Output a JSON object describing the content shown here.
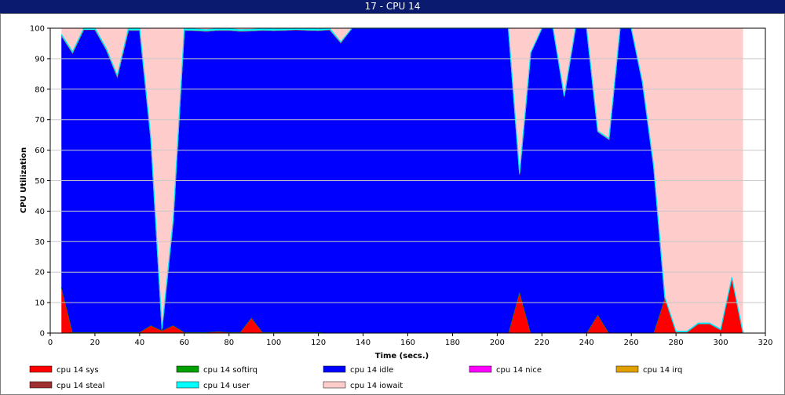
{
  "window": {
    "title": "17 - CPU 14"
  },
  "chart_data": {
    "type": "area",
    "stacked": true,
    "title": "17 - CPU 14",
    "xlabel": "Time (secs.)",
    "ylabel": "CPU Utilization",
    "xlim": [
      0,
      320
    ],
    "ylim": [
      0,
      100
    ],
    "xticks": [
      0,
      20,
      40,
      60,
      80,
      100,
      120,
      140,
      160,
      180,
      200,
      220,
      240,
      260,
      280,
      300,
      320
    ],
    "yticks": [
      0,
      10,
      20,
      30,
      40,
      50,
      60,
      70,
      80,
      90,
      100
    ],
    "grid": "horizontal",
    "legend_position": "bottom",
    "x": [
      5,
      10,
      15,
      20,
      25,
      30,
      35,
      40,
      45,
      50,
      55,
      60,
      65,
      70,
      75,
      80,
      85,
      90,
      95,
      100,
      105,
      110,
      115,
      120,
      125,
      130,
      135,
      140,
      145,
      150,
      155,
      160,
      165,
      170,
      175,
      180,
      185,
      190,
      195,
      200,
      205,
      210,
      215,
      220,
      225,
      230,
      235,
      240,
      245,
      250,
      255,
      260,
      265,
      270,
      275,
      280,
      285,
      290,
      295,
      300,
      305,
      310
    ],
    "series": [
      {
        "name": "cpu 14 sys",
        "color": "#ff0000",
        "values": [
          15,
          0.3,
          0.3,
          0.3,
          0.3,
          0.3,
          0.3,
          0.3,
          2.5,
          0.8,
          2.5,
          0.3,
          0.3,
          0.3,
          0.5,
          0.3,
          0.3,
          5,
          0.3,
          0.3,
          0.3,
          0.3,
          0.3,
          0.3,
          0,
          0,
          0,
          0,
          0,
          0,
          0,
          0,
          0,
          0,
          0,
          0,
          0,
          0,
          0,
          0,
          0,
          13.5,
          0,
          0,
          0,
          0,
          0,
          0,
          6,
          0,
          0,
          0,
          0,
          0,
          11.5,
          0.3,
          0.3,
          3,
          3,
          1,
          18,
          0
        ]
      },
      {
        "name": "cpu 14 softirq",
        "color": "#00a000",
        "values": [
          0,
          0,
          0,
          0,
          0,
          0,
          0,
          0,
          0,
          0,
          0,
          0,
          0,
          0,
          0,
          0,
          0,
          0,
          0,
          0,
          0,
          0,
          0,
          0,
          0,
          0,
          0,
          0,
          0,
          0,
          0,
          0,
          0,
          0,
          0,
          0,
          0,
          0,
          0,
          0,
          0,
          0,
          0,
          0,
          0,
          0,
          0,
          0,
          0,
          0,
          0,
          0,
          0,
          0,
          0,
          0,
          0,
          0,
          0,
          0,
          0,
          0
        ]
      },
      {
        "name": "cpu 14 idle",
        "color": "#0000ff",
        "values": [
          82.5,
          91.5,
          99.2,
          99.2,
          92.7,
          83.7,
          99,
          99,
          61,
          0.2,
          34,
          99,
          98.9,
          98.7,
          98.8,
          99,
          98.7,
          94.1,
          99,
          98.9,
          99,
          99.2,
          99,
          98.9,
          99.5,
          95.2,
          100,
          100,
          100,
          100,
          100,
          100,
          100,
          100,
          100,
          100,
          100,
          100,
          100,
          100,
          100,
          38.5,
          92,
          100,
          100,
          77.5,
          100,
          100,
          60,
          63.5,
          100,
          100,
          82,
          54.5,
          0,
          0,
          0,
          0,
          0,
          0,
          0,
          0
        ]
      },
      {
        "name": "cpu 14 nice",
        "color": "#ff00ff",
        "values": [
          0,
          0,
          0,
          0,
          0,
          0,
          0,
          0,
          0,
          0,
          0,
          0,
          0,
          0,
          0,
          0,
          0,
          0,
          0,
          0,
          0,
          0,
          0,
          0,
          0,
          0,
          0,
          0,
          0,
          0,
          0,
          0,
          0,
          0,
          0,
          0,
          0,
          0,
          0,
          0,
          0,
          0,
          0,
          0,
          0,
          0,
          0,
          0,
          0,
          0,
          0,
          0,
          0,
          0,
          0,
          0,
          0,
          0,
          0,
          0,
          0,
          0
        ]
      },
      {
        "name": "cpu 14 irq",
        "color": "#e0a000",
        "values": [
          0,
          0,
          0,
          0,
          0,
          0,
          0,
          0,
          0,
          0,
          0,
          0,
          0,
          0,
          0,
          0,
          0,
          0,
          0,
          0,
          0,
          0,
          0,
          0,
          0,
          0,
          0,
          0,
          0,
          0,
          0,
          0,
          0,
          0,
          0,
          0,
          0,
          0,
          0,
          0,
          0,
          0,
          0,
          0,
          0,
          0,
          0,
          0,
          0,
          0,
          0,
          0,
          0,
          0,
          0,
          0,
          0,
          0,
          0,
          0,
          0,
          0
        ]
      },
      {
        "name": "cpu 14 steal",
        "color": "#a03030",
        "values": [
          0,
          0,
          0,
          0,
          0,
          0,
          0,
          0,
          0,
          0,
          0,
          0,
          0,
          0,
          0,
          0,
          0,
          0,
          0,
          0,
          0,
          0,
          0,
          0,
          0,
          0,
          0,
          0,
          0,
          0,
          0,
          0,
          0,
          0,
          0,
          0,
          0,
          0,
          0,
          0,
          0,
          0,
          0,
          0,
          0,
          0,
          0,
          0,
          0,
          0,
          0,
          0,
          0,
          0,
          0,
          0,
          0,
          0,
          0,
          0,
          0,
          0
        ]
      },
      {
        "name": "cpu 14 user",
        "color": "#00ffff",
        "values": [
          0.5,
          0.5,
          0.5,
          0.5,
          0.5,
          0.5,
          0.7,
          0.7,
          0.5,
          0.5,
          0.5,
          0.7,
          0.5,
          0.5,
          0.5,
          0.5,
          0.5,
          0.5,
          0.5,
          0.5,
          0.5,
          0.5,
          0.5,
          0.5,
          0.5,
          0.3,
          0,
          0,
          0,
          0,
          0,
          0,
          0,
          0,
          0,
          0,
          0,
          0,
          0,
          0,
          0,
          0.5,
          0,
          0,
          0,
          0.3,
          0,
          0,
          0.3,
          0.3,
          0,
          0,
          0.3,
          0.3,
          0.3,
          0.3,
          0.3,
          0.3,
          0.3,
          0.3,
          0.3,
          0
        ]
      },
      {
        "name": "cpu 14 iowait",
        "color": "#ffcccc",
        "values": [
          2,
          7.7,
          0,
          0,
          6.5,
          15.5,
          0,
          0,
          36,
          98.5,
          63,
          0,
          0.3,
          0.5,
          0.2,
          0.2,
          0.5,
          0.4,
          0.2,
          0.3,
          0.2,
          0,
          0.2,
          0.3,
          0,
          4.5,
          0,
          0,
          0,
          0,
          0,
          0,
          0,
          0,
          0,
          0,
          0,
          0,
          0,
          0,
          0,
          47.5,
          8,
          0,
          0,
          22.2,
          0,
          0,
          33.7,
          36.2,
          0,
          0,
          17.7,
          45.2,
          88.2,
          99.4,
          99.4,
          96.7,
          96.7,
          98.7,
          81.7,
          100
        ]
      }
    ]
  }
}
